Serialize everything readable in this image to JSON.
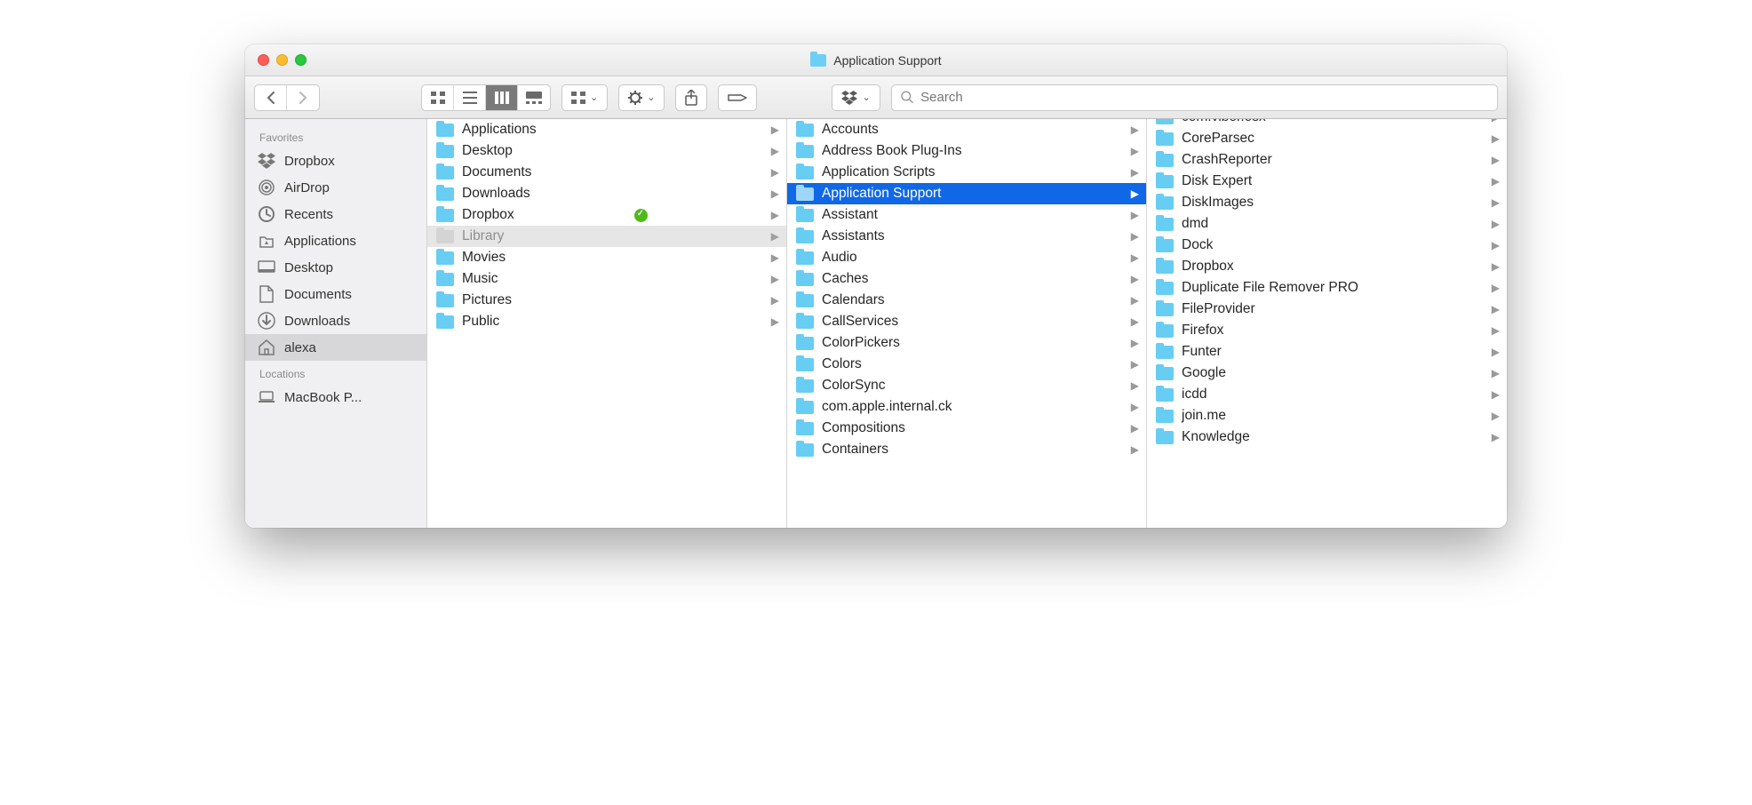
{
  "window": {
    "title": "Application Support"
  },
  "toolbar": {
    "search_placeholder": "Search"
  },
  "sidebar": {
    "sections": [
      {
        "heading": "Favorites",
        "items": [
          {
            "icon": "dropbox",
            "label": "Dropbox",
            "selected": false
          },
          {
            "icon": "airdrop",
            "label": "AirDrop",
            "selected": false
          },
          {
            "icon": "recents",
            "label": "Recents",
            "selected": false
          },
          {
            "icon": "applications",
            "label": "Applications",
            "selected": false
          },
          {
            "icon": "desktop",
            "label": "Desktop",
            "selected": false
          },
          {
            "icon": "documents",
            "label": "Documents",
            "selected": false
          },
          {
            "icon": "downloads",
            "label": "Downloads",
            "selected": false
          },
          {
            "icon": "home",
            "label": "alexa",
            "selected": true
          }
        ]
      },
      {
        "heading": "Locations",
        "items": [
          {
            "icon": "laptop",
            "label": "MacBook P...",
            "selected": false
          }
        ]
      }
    ]
  },
  "columns": [
    {
      "items": [
        {
          "label": "Applications",
          "has_children": true
        },
        {
          "label": "Desktop",
          "has_children": true
        },
        {
          "label": "Documents",
          "has_children": true
        },
        {
          "label": "Downloads",
          "has_children": true
        },
        {
          "label": "Dropbox",
          "has_children": true,
          "sync_badge": true
        },
        {
          "label": "Library",
          "has_children": true,
          "open_path": true
        },
        {
          "label": "Movies",
          "has_children": true
        },
        {
          "label": "Music",
          "has_children": true
        },
        {
          "label": "Pictures",
          "has_children": true
        },
        {
          "label": "Public",
          "has_children": true
        }
      ]
    },
    {
      "items": [
        {
          "label": "Accounts",
          "has_children": true
        },
        {
          "label": "Address Book Plug-Ins",
          "has_children": true
        },
        {
          "label": "Application Scripts",
          "has_children": true
        },
        {
          "label": "Application Support",
          "has_children": true,
          "selected": true
        },
        {
          "label": "Assistant",
          "has_children": true
        },
        {
          "label": "Assistants",
          "has_children": true
        },
        {
          "label": "Audio",
          "has_children": true
        },
        {
          "label": "Caches",
          "has_children": true
        },
        {
          "label": "Calendars",
          "has_children": true
        },
        {
          "label": "CallServices",
          "has_children": true
        },
        {
          "label": "ColorPickers",
          "has_children": true
        },
        {
          "label": "Colors",
          "has_children": true
        },
        {
          "label": "ColorSync",
          "has_children": true
        },
        {
          "label": "com.apple.internal.ck",
          "has_children": true
        },
        {
          "label": "Compositions",
          "has_children": true
        },
        {
          "label": "Containers",
          "has_children": true
        }
      ]
    },
    {
      "items": [
        {
          "label": "com.viber.osx",
          "has_children": true,
          "partial_top": true
        },
        {
          "label": "CoreParsec",
          "has_children": true
        },
        {
          "label": "CrashReporter",
          "has_children": true
        },
        {
          "label": "Disk Expert",
          "has_children": true
        },
        {
          "label": "DiskImages",
          "has_children": true
        },
        {
          "label": "dmd",
          "has_children": true
        },
        {
          "label": "Dock",
          "has_children": true
        },
        {
          "label": "Dropbox",
          "has_children": true
        },
        {
          "label": "Duplicate File Remover PRO",
          "has_children": true
        },
        {
          "label": "FileProvider",
          "has_children": true
        },
        {
          "label": "Firefox",
          "has_children": true
        },
        {
          "label": "Funter",
          "has_children": true
        },
        {
          "label": "Google",
          "has_children": true
        },
        {
          "label": "icdd",
          "has_children": true
        },
        {
          "label": "join.me",
          "has_children": true
        },
        {
          "label": "Knowledge",
          "has_children": true
        }
      ]
    }
  ]
}
